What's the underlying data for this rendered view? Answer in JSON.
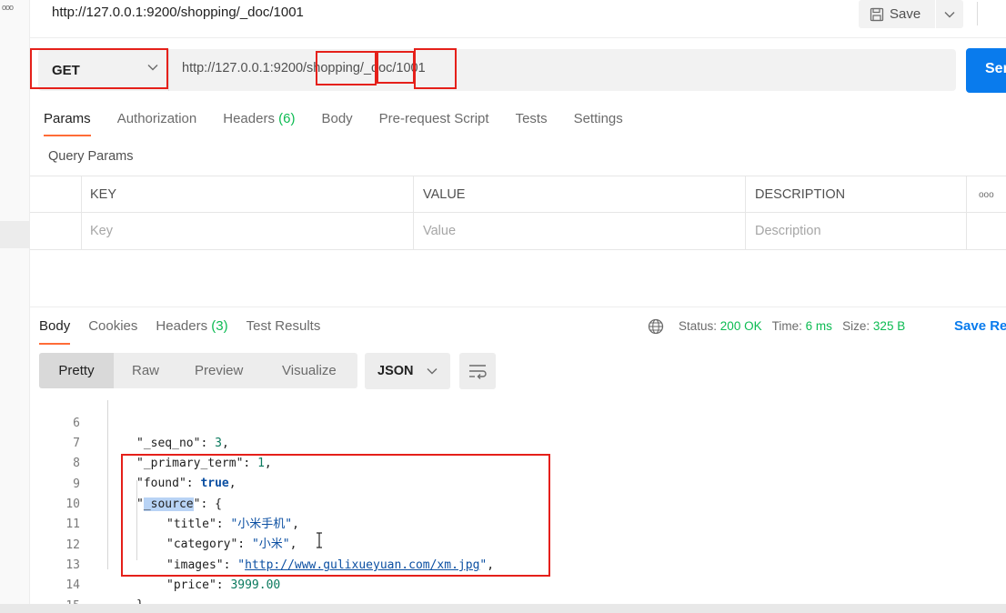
{
  "sidebar": {
    "dots": "ooo"
  },
  "header": {
    "title": "http://127.0.0.1:9200/shopping/_doc/1001",
    "save_label": "Save"
  },
  "request": {
    "method": "GET",
    "url": "http://127.0.0.1:9200/shopping/_doc/1001",
    "send_label": "Sen"
  },
  "request_tabs": {
    "params": "Params",
    "authorization": "Authorization",
    "headers": "Headers",
    "headers_count": "(6)",
    "body": "Body",
    "prerequest": "Pre-request Script",
    "tests": "Tests",
    "settings": "Settings"
  },
  "query_params": {
    "title": "Query Params",
    "columns": [
      "KEY",
      "VALUE",
      "DESCRIPTION"
    ],
    "placeholders": [
      "Key",
      "Value",
      "Description"
    ],
    "more": "ooo"
  },
  "response_tabs": {
    "body": "Body",
    "cookies": "Cookies",
    "headers": "Headers",
    "headers_count": "(3)",
    "test_results": "Test Results"
  },
  "status": {
    "status_label": "Status:",
    "status_value": "200 OK",
    "time_label": "Time:",
    "time_value": "6 ms",
    "size_label": "Size:",
    "size_value": "325 B",
    "save_response": "Save Re"
  },
  "view_modes": [
    "Pretty",
    "Raw",
    "Preview",
    "Visualize"
  ],
  "format": "JSON",
  "code_lines": {
    "n6": "6",
    "n7": "7",
    "n8": "8",
    "n9": "9",
    "n10": "10",
    "n11": "11",
    "n12": "12",
    "n13": "13",
    "n14": "14",
    "n15": "15",
    "seq_no_key": "\"_seq_no\"",
    "seq_no_val": "3",
    "primary_term_key": "\"_primary_term\"",
    "primary_term_val": "1",
    "found_key": "\"found\"",
    "found_val": "true",
    "source_key_open": "\"",
    "source_key_word": "_source",
    "source_key_close": "\"",
    "title_key": "\"title\"",
    "title_val": "\"小米手机\"",
    "category_key": "\"category\"",
    "category_val": "\"小米\"",
    "images_key": "\"images\"",
    "images_url": "http://www.gulixueyuan.com/xm.jpg",
    "price_key": "\"price\"",
    "price_val": "3999.00"
  }
}
